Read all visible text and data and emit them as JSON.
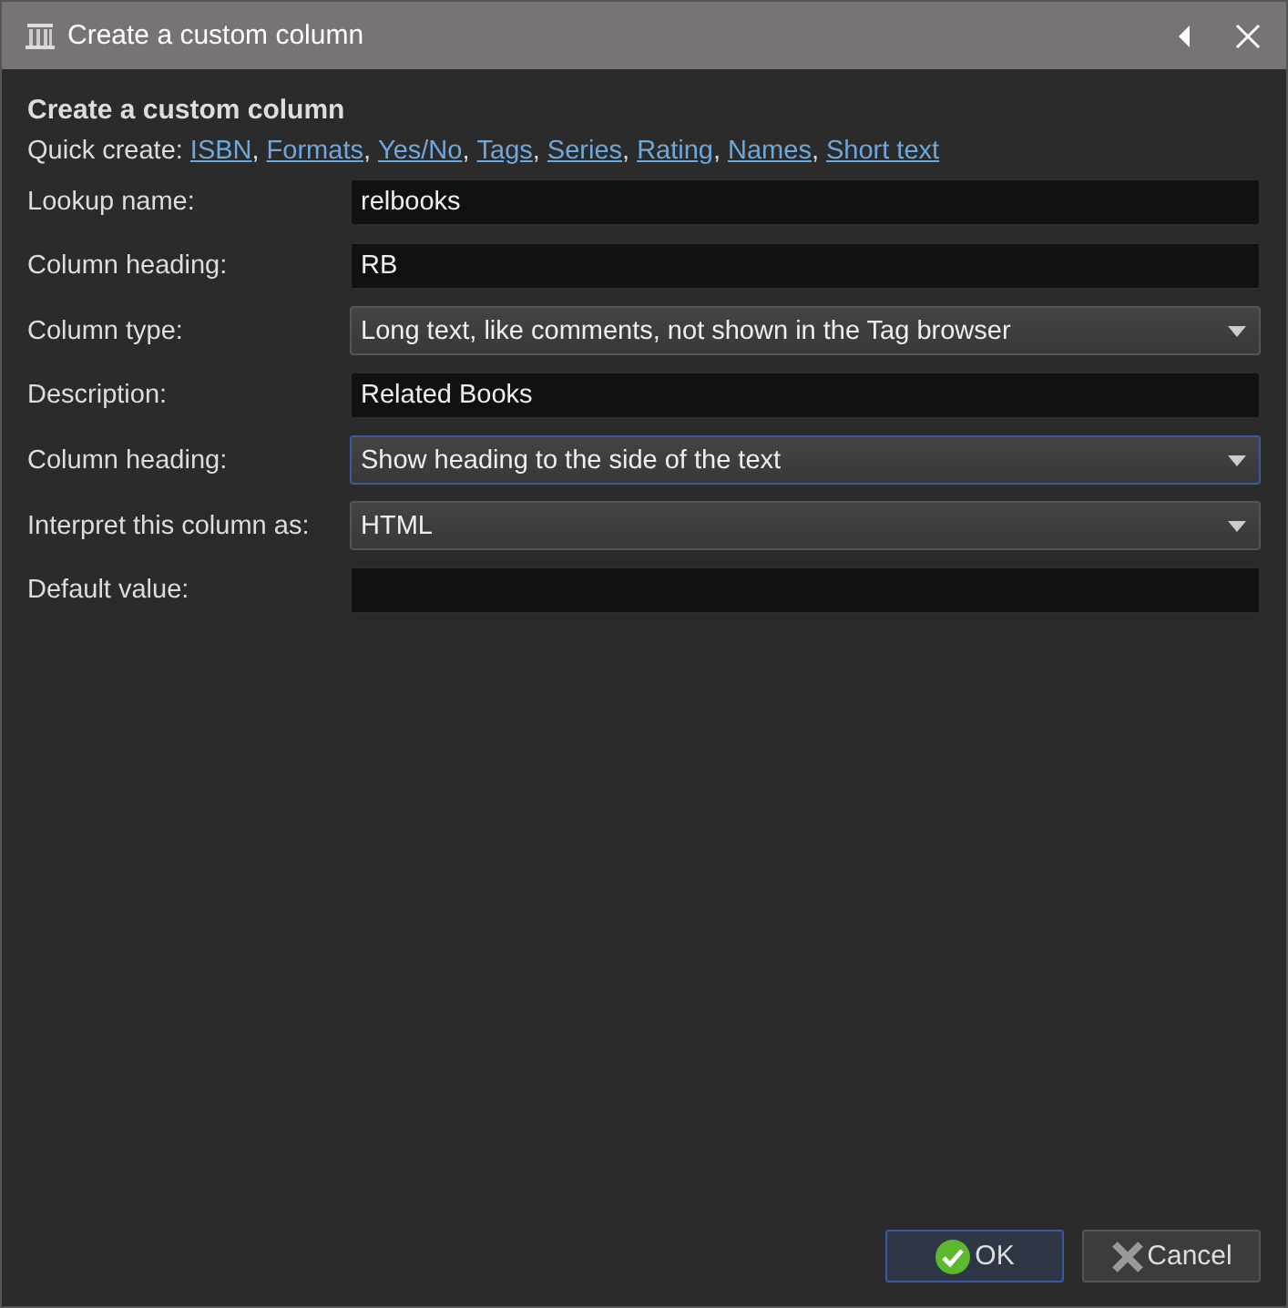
{
  "window": {
    "title": "Create a custom column"
  },
  "heading": "Create a custom column",
  "quick_create": {
    "label": "Quick create:",
    "links": [
      {
        "text": "ISBN",
        "separator": ","
      },
      {
        "text": "Formats",
        "separator": ","
      },
      {
        "text": "Yes/No",
        "separator": ","
      },
      {
        "text": "Tags",
        "separator": ","
      },
      {
        "text": "Series",
        "separator": ","
      },
      {
        "text": "Rating",
        "separator": ","
      },
      {
        "text": "Names",
        "separator": ","
      },
      {
        "text": "Short text"
      }
    ]
  },
  "fields": [
    {
      "label": "Lookup name:",
      "kind": "text",
      "value": "relbooks",
      "focused": false
    },
    {
      "label": "Column heading:",
      "kind": "text",
      "value": "RB",
      "focused": false
    },
    {
      "label": "Column type:",
      "kind": "dropdown",
      "value": "Long text, like comments, not shown in the Tag browser",
      "focused": false
    },
    {
      "label": "Description:",
      "kind": "text",
      "value": "Related Books",
      "focused": false
    },
    {
      "label": "Column heading:",
      "kind": "dropdown",
      "value": "Show heading to the side of the text",
      "focused": true
    },
    {
      "label": "Interpret this column as:",
      "kind": "dropdown",
      "value": "HTML",
      "focused": false
    },
    {
      "label": "Default value:",
      "kind": "text",
      "focused": false
    }
  ],
  "buttons": [
    {
      "label": "OK",
      "kind": "ok",
      "default": true
    },
    {
      "label": "Cancel",
      "kind": "cancel",
      "default": false
    }
  ]
}
